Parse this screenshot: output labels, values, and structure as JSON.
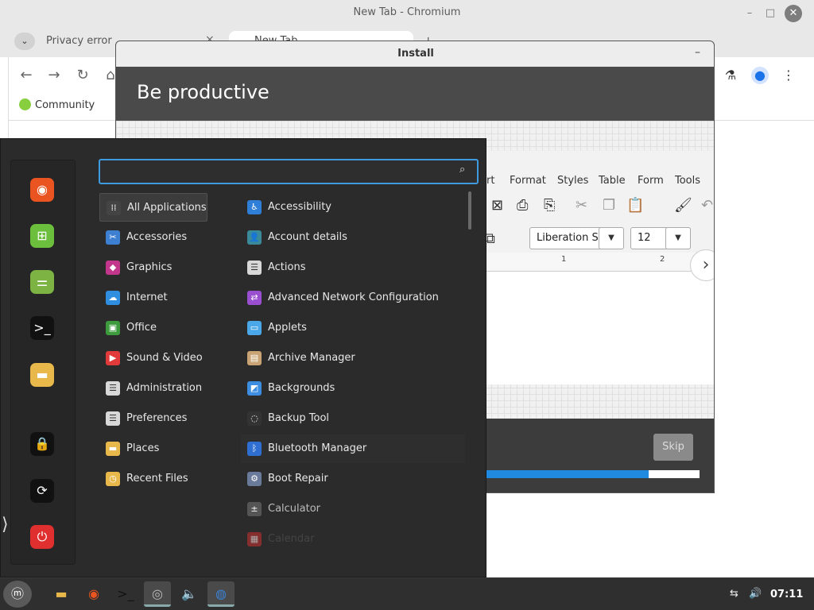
{
  "chromium": {
    "window_title": "New Tab - Chromium",
    "tab1_label": "Privacy error",
    "tab2_label": "New Tab",
    "bookmark_label": "Community"
  },
  "install": {
    "title": "Install",
    "heading": "Be productive",
    "skip_label": "Skip",
    "progress_percent": 91,
    "writer": {
      "menus": [
        "ert",
        "Format",
        "Styles",
        "Table",
        "Form",
        "Tools"
      ],
      "font_name": "Liberation S",
      "font_size": "12",
      "ruler": [
        "1",
        "2"
      ]
    }
  },
  "menu": {
    "search": {
      "placeholder": "",
      "value": ""
    },
    "favorites": [
      {
        "name": "firefox-icon",
        "color": "#e95420",
        "glyph": "◉"
      },
      {
        "name": "network-icon",
        "color": "#6cbf3c",
        "glyph": "⊞"
      },
      {
        "name": "settings-toggle-icon",
        "color": "#7cb342",
        "glyph": "⚌"
      },
      {
        "name": "terminal-icon",
        "color": "#111111",
        "glyph": ">_"
      },
      {
        "name": "folder-icon",
        "color": "#e8b84a",
        "glyph": "▬"
      },
      {
        "name": "lock-icon",
        "color": "#111111",
        "glyph": "🔒"
      },
      {
        "name": "logout-icon",
        "color": "#111111",
        "glyph": "⟳"
      },
      {
        "name": "power-icon",
        "color": "#e02f2f",
        "glyph": "⏻"
      }
    ],
    "categories": [
      {
        "label": "All Applications",
        "icon": "grid-icon",
        "color": "#444444",
        "glyph": "⁞⁞"
      },
      {
        "label": "Accessories",
        "icon": "scissors-icon",
        "color": "#3d7fd1",
        "glyph": "✂"
      },
      {
        "label": "Graphics",
        "icon": "graphics-icon",
        "color": "#c2378b",
        "glyph": "◆"
      },
      {
        "label": "Internet",
        "icon": "cloud-icon",
        "color": "#2f8ee0",
        "glyph": "☁"
      },
      {
        "label": "Office",
        "icon": "office-icon",
        "color": "#3d9a3d",
        "glyph": "▣"
      },
      {
        "label": "Sound & Video",
        "icon": "play-icon",
        "color": "#e03a3a",
        "glyph": "▶"
      },
      {
        "label": "Administration",
        "icon": "admin-icon",
        "color": "#d8d8d8",
        "glyph": "☰"
      },
      {
        "label": "Preferences",
        "icon": "preferences-icon",
        "color": "#d8d8d8",
        "glyph": "☰"
      },
      {
        "label": "Places",
        "icon": "folder-icon",
        "color": "#e8b84a",
        "glyph": "▬"
      },
      {
        "label": "Recent Files",
        "icon": "recent-folder-icon",
        "color": "#e8b84a",
        "glyph": "◷"
      }
    ],
    "apps": [
      {
        "label": "Accessibility",
        "icon": "accessibility-icon",
        "color": "#2f7ed8",
        "glyph": "♿"
      },
      {
        "label": "Account details",
        "icon": "account-icon",
        "color": "#3a8a9a",
        "glyph": "👤"
      },
      {
        "label": "Actions",
        "icon": "actions-icon",
        "color": "#d8d8d8",
        "glyph": "☰"
      },
      {
        "label": "Advanced Network Configuration",
        "icon": "network-config-icon",
        "color": "#9a4fd1",
        "glyph": "⇄"
      },
      {
        "label": "Applets",
        "icon": "applets-icon",
        "color": "#4aa8e8",
        "glyph": "▭"
      },
      {
        "label": "Archive Manager",
        "icon": "archive-icon",
        "color": "#c9a374",
        "glyph": "▤"
      },
      {
        "label": "Backgrounds",
        "icon": "backgrounds-icon",
        "color": "#3d8ee0",
        "glyph": "◩"
      },
      {
        "label": "Backup Tool",
        "icon": "backup-icon",
        "color": "#333333",
        "glyph": "◌"
      },
      {
        "label": "Bluetooth Manager",
        "icon": "bluetooth-icon",
        "color": "#2f6fd1",
        "glyph": "ᛒ"
      },
      {
        "label": "Boot Repair",
        "icon": "boot-repair-icon",
        "color": "#6a7a9a",
        "glyph": "⚙"
      },
      {
        "label": "Calculator",
        "icon": "calculator-icon",
        "color": "#555555",
        "glyph": "±"
      },
      {
        "label": "Calendar",
        "icon": "calendar-icon",
        "color": "#c03030",
        "glyph": "▦"
      }
    ]
  },
  "taskbar": {
    "clock": "07:11",
    "apps": [
      {
        "name": "files-taskbar-icon",
        "glyph": "▬",
        "color": "#e8b84a",
        "active": false
      },
      {
        "name": "firefox-taskbar-icon",
        "glyph": "◉",
        "color": "#e95420",
        "active": false
      },
      {
        "name": "terminal-taskbar-icon",
        "glyph": ">_",
        "color": "#111111",
        "active": false
      },
      {
        "name": "installer-taskbar-icon",
        "glyph": "◎",
        "color": "#bbbbbb",
        "active": true
      },
      {
        "name": "sound-taskbar-icon",
        "glyph": "🔈",
        "color": "#999999",
        "active": false
      },
      {
        "name": "chromium-taskbar-icon",
        "glyph": "◍",
        "color": "#3b82d6",
        "active": true
      }
    ]
  }
}
